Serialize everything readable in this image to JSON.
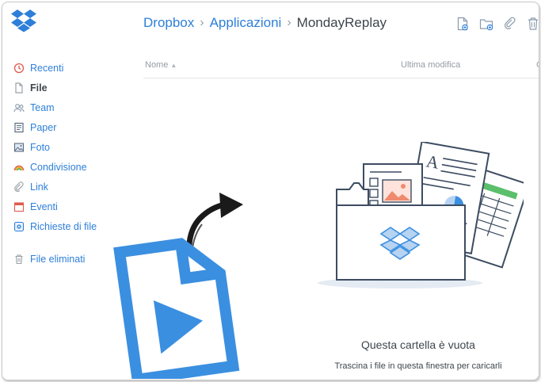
{
  "brand": {
    "logo": "dropbox-logo",
    "accent": "#2d7fd9"
  },
  "sidebar": {
    "items": [
      {
        "label": "Recenti",
        "icon": "clock-icon"
      },
      {
        "label": "File",
        "icon": "file-icon",
        "active": true
      },
      {
        "label": "Team",
        "icon": "team-icon"
      },
      {
        "label": "Paper",
        "icon": "paper-icon"
      },
      {
        "label": "Foto",
        "icon": "photo-icon"
      },
      {
        "label": "Condivisione",
        "icon": "rainbow-icon"
      },
      {
        "label": "Link",
        "icon": "link-icon"
      },
      {
        "label": "Eventi",
        "icon": "calendar-icon"
      },
      {
        "label": "Richieste di file",
        "icon": "file-request-icon"
      }
    ],
    "deleted": {
      "label": "File eliminati",
      "icon": "trash-icon"
    }
  },
  "breadcrumb": {
    "root": "Dropbox",
    "parent": "Applicazioni",
    "current": "MondayReplay"
  },
  "toolbar": {
    "icons": [
      "upload-file-icon",
      "new-folder-icon",
      "link-icon",
      "delete-icon"
    ]
  },
  "columns": {
    "name": "Nome",
    "modified": "Ultima modifica",
    "extra": "C"
  },
  "empty_state": {
    "title": "Questa cartella è vuota",
    "subtitle": "Trascina i file in questa finestra per caricarli"
  },
  "overlay": {
    "file_icon": "video-file-icon",
    "arrow": "curved-arrow-icon",
    "file_color": "#3b8fe0"
  }
}
